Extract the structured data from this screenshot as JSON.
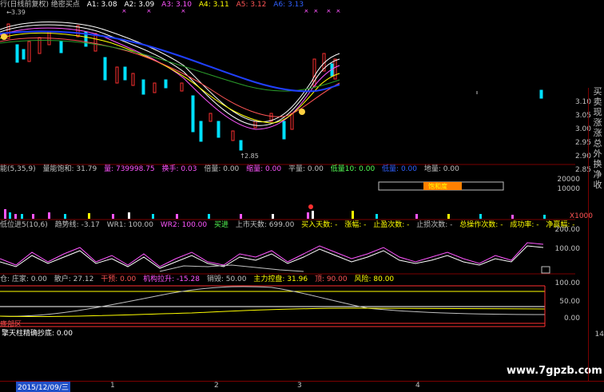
{
  "main": {
    "title": "行(日线前复权) 绝密买点",
    "ma": [
      {
        "label": "A1: 3.08",
        "color": "#ffffff"
      },
      {
        "label": "A2: 3.09",
        "color": "#ffffff"
      },
      {
        "label": "A3: 3.10",
        "color": "#ff55ff"
      },
      {
        "label": "A4: 3.11",
        "color": "#ffff00"
      },
      {
        "label": "A5: 3.12",
        "color": "#ff5555"
      },
      {
        "label": "A6: 3.13",
        "color": "#3060ff"
      }
    ],
    "high_marker": "3.39",
    "low_marker": "2.85",
    "price_axis": [
      "3.10",
      "3.05",
      "3.00",
      "2.95",
      "2.90",
      "2.85"
    ]
  },
  "volume_panel": {
    "items": [
      {
        "label": "能(5,35,9)",
        "color": "#c0c0c0"
      },
      {
        "label": "量能饱和: 31.79",
        "color": "#c0c0c0"
      },
      {
        "label": "量: 739998.75",
        "color": "#ff55ff"
      },
      {
        "label": "换手: 0.03",
        "color": "#ff55ff"
      },
      {
        "label": "倍量: 0.00",
        "color": "#c0c0c0"
      },
      {
        "label": "缩量: 0.00",
        "color": "#ff55ff"
      },
      {
        "label": "平量: 0.00",
        "color": "#c0c0c0"
      },
      {
        "label": "低量10: 0.00",
        "color": "#55ff55"
      },
      {
        "label": "低量: 0.00",
        "color": "#3060ff"
      },
      {
        "label": "地量: 0.00",
        "color": "#c0c0c0"
      }
    ],
    "box_label": "饱和度",
    "axis": [
      "20000",
      "10000",
      "X1000"
    ]
  },
  "buy_panel": {
    "items": [
      {
        "label": "低位进5(10,6)",
        "color": "#c0c0c0"
      },
      {
        "label": "趋势线: -3.17",
        "color": "#c0c0c0"
      },
      {
        "label": "WR1: 100.00",
        "color": "#c0c0c0"
      },
      {
        "label": "WR2: 100.00",
        "color": "#ff55ff"
      },
      {
        "label": "买进",
        "color": "#55ff55"
      },
      {
        "label": "上市天数: 699.00",
        "color": "#c0c0c0"
      },
      {
        "label": "买入天数: -",
        "color": "#ffff00"
      },
      {
        "label": "涨幅: -",
        "color": "#ffff00"
      },
      {
        "label": "止盈次数: -",
        "color": "#ffff00"
      },
      {
        "label": "止损次数: -",
        "color": "#c0c0c0"
      },
      {
        "label": "总操作次数: -",
        "color": "#ffff00"
      },
      {
        "label": "成功率: -",
        "color": "#ffff00"
      },
      {
        "label": "净赢幅: -",
        "color": "#ffff00"
      }
    ],
    "axis": [
      "200.00",
      "100.00"
    ]
  },
  "control_panel": {
    "items": [
      {
        "label": "仓: 庄家: 0.00",
        "color": "#c0c0c0"
      },
      {
        "label": "散户: 27.12",
        "color": "#c0c0c0"
      },
      {
        "label": "干预: 0.00",
        "color": "#ff5555"
      },
      {
        "label": "机构拉升: -15.28",
        "color": "#ff55ff"
      },
      {
        "label": "销毁: 50.00",
        "color": "#c0c0c0"
      },
      {
        "label": "主力控盘: 31.96",
        "color": "#ffff00"
      },
      {
        "label": "顶: 90.00",
        "color": "#ff5555"
      },
      {
        "label": "风险: 80.00",
        "color": "#ffff00"
      }
    ],
    "axis": [
      "100.00",
      "50.00",
      "0.00"
    ],
    "bottom_label": "底部区"
  },
  "bottom_panel": {
    "label": "擎天柱精确抄底: 0.00"
  },
  "x_axis": {
    "date_tag": "2015/12/09/三",
    "ticks": [
      "1",
      "2",
      "3",
      "4"
    ]
  },
  "sidebar_labels": [
    "买",
    "卖",
    "现",
    "涨",
    "涨",
    "总",
    "外",
    "换",
    "净",
    "收"
  ],
  "watermark": "www.7gpzb.com"
}
